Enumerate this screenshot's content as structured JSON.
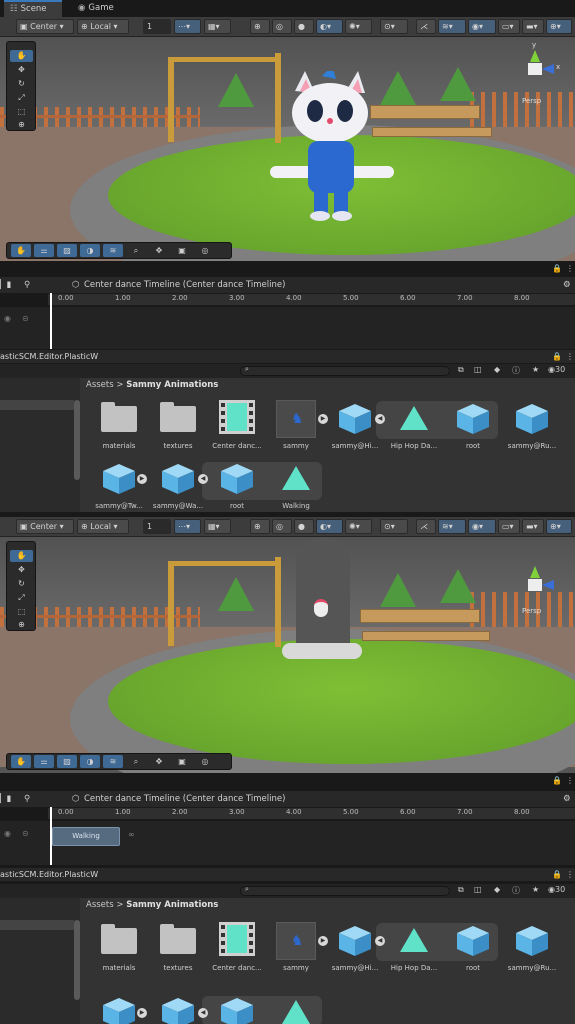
{
  "top_tabs": {
    "scene": "Scene",
    "game": "Game"
  },
  "toolbar": {
    "pivot": "Center",
    "space": "Local",
    "snap_value": "1"
  },
  "gizmo": {
    "projection": "Persp",
    "axis_y": "y",
    "axis_x": "x"
  },
  "timeline": {
    "title": "Center dance Timeline (Center dance Timeline)",
    "ticks": [
      "0.00",
      "1.00",
      "2.00",
      "3.00",
      "4.00",
      "5.00",
      "6.00",
      "7.00",
      "8.00"
    ],
    "clip_label": "Walking"
  },
  "project": {
    "console_text": "asticSCM.Editor.PlasticW",
    "breadcrumb_root": "Assets",
    "breadcrumb_sep": ">",
    "breadcrumb_current": "Sammy Animations",
    "count": "30",
    "assets_row1": [
      "materials",
      "textures",
      "Center danc...",
      "sammy",
      "sammy@Hi...",
      "Hip Hop Da...",
      "root",
      "sammy@Ru..."
    ],
    "assets_row2": [
      "sammy@Tw...",
      "sammy@Wa...",
      "root",
      "Walking"
    ]
  },
  "colors": {
    "accent": "#3a79bb",
    "grass": "#6fae2f",
    "anim": "#5fe2c8",
    "box": "#5ab4e6"
  }
}
